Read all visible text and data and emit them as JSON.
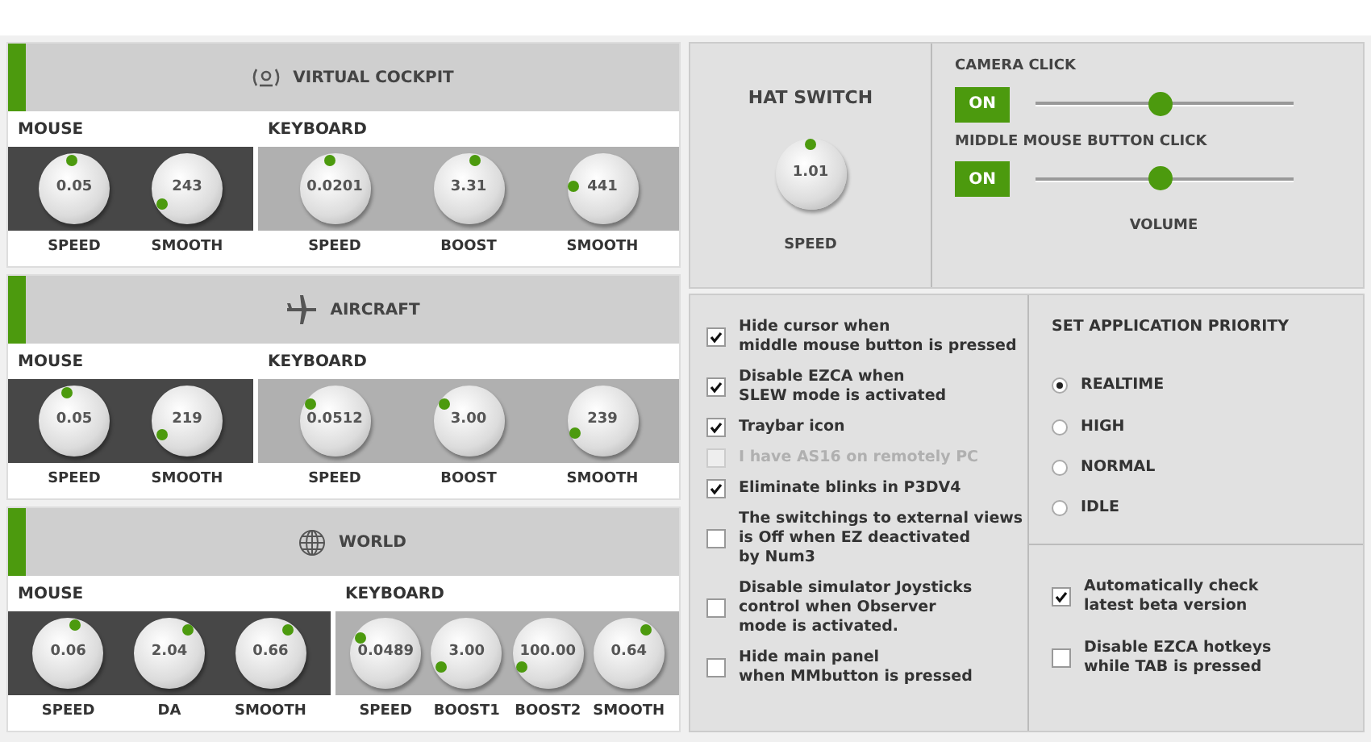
{
  "sections": [
    {
      "kind": "cockpit",
      "title": "VIRTUAL COCKPIT",
      "mouse": {
        "label": "MOUSE",
        "knobs": [
          {
            "value": "0.05",
            "label": "SPEED"
          },
          {
            "value": "243",
            "label": "SMOOTH"
          }
        ]
      },
      "keyboard": {
        "label": "KEYBOARD",
        "knobs": [
          {
            "value": "0.0201",
            "label": "SPEED"
          },
          {
            "value": "3.31",
            "label": "BOOST"
          },
          {
            "value": "441",
            "label": "SMOOTH"
          }
        ]
      }
    },
    {
      "kind": "aircraft",
      "title": "AIRCRAFT",
      "mouse": {
        "label": "MOUSE",
        "knobs": [
          {
            "value": "0.05",
            "label": "SPEED"
          },
          {
            "value": "219",
            "label": "SMOOTH"
          }
        ]
      },
      "keyboard": {
        "label": "KEYBOARD",
        "knobs": [
          {
            "value": "0.0512",
            "label": "SPEED"
          },
          {
            "value": "3.00",
            "label": "BOOST"
          },
          {
            "value": "239",
            "label": "SMOOTH"
          }
        ]
      }
    },
    {
      "kind": "world",
      "title": "WORLD",
      "mouse": {
        "label": "MOUSE",
        "knobs": [
          {
            "value": "0.06",
            "label": "SPEED"
          },
          {
            "value": "2.04",
            "label": "DA"
          },
          {
            "value": "0.66",
            "label": "SMOOTH"
          }
        ]
      },
      "keyboard": {
        "label": "KEYBOARD",
        "knobs": [
          {
            "value": "0.0489",
            "label": "SPEED"
          },
          {
            "value": "3.00",
            "label": "BOOST1"
          },
          {
            "value": "100.00",
            "label": "BOOST2"
          },
          {
            "value": "0.64",
            "label": "SMOOTH"
          }
        ]
      }
    }
  ],
  "hat_switch": {
    "title": "HAT SWITCH",
    "knob": {
      "value": "1.01",
      "label": "SPEED"
    }
  },
  "sounds": [
    {
      "label": "CAMERA CLICK",
      "toggle": "ON",
      "on": true,
      "level": 0.48
    },
    {
      "label": "MIDDLE MOUSE BUTTON CLICK",
      "toggle": "ON",
      "on": true,
      "level": 0.48
    }
  ],
  "volume_label": "VOLUME",
  "options": [
    {
      "label": "Hide cursor when\nmiddle mouse button is pressed",
      "checked": true,
      "disabled": false
    },
    {
      "label": "Disable EZCA when\nSLEW mode is activated",
      "checked": true,
      "disabled": false
    },
    {
      "label": "Traybar icon",
      "checked": true,
      "disabled": false
    },
    {
      "label": "I have AS16 on remotely PC",
      "checked": false,
      "disabled": true
    },
    {
      "label": "Eliminate blinks in P3DV4",
      "checked": true,
      "disabled": false
    },
    {
      "label": "The switchings to external views\nis Off when EZ deactivated\nby Num3",
      "checked": false,
      "disabled": false
    },
    {
      "label": "Disable simulator Joysticks\ncontrol when Observer\nmode is activated.",
      "checked": false,
      "disabled": false
    },
    {
      "label": "Hide main panel\nwhen MMbutton is pressed",
      "checked": false,
      "disabled": false
    }
  ],
  "priority": {
    "title": "SET APPLICATION PRIORITY",
    "options": [
      {
        "label": "REALTIME",
        "selected": true
      },
      {
        "label": "HIGH",
        "selected": false
      },
      {
        "label": "NORMAL",
        "selected": false
      },
      {
        "label": "IDLE",
        "selected": false
      }
    ]
  },
  "extra_options": [
    {
      "label": "Automatically check\nlatest beta version",
      "checked": true
    },
    {
      "label": "Disable EZCA hotkeys\nwhile TAB is pressed",
      "checked": false
    }
  ]
}
